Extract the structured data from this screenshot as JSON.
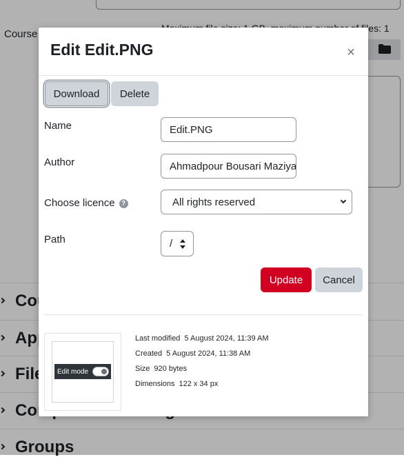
{
  "background": {
    "course_label": "Course",
    "max_size_text": "Maximum file size: 1 GB, maximum number of files: 1",
    "sections": [
      "Course",
      "Appearance",
      "Files",
      "Completion tracking",
      "Groups"
    ]
  },
  "dialog": {
    "title": "Edit Edit.PNG",
    "close_symbol": "×",
    "download_label": "Download",
    "delete_label": "Delete",
    "name_label": "Name",
    "name_value": "Edit.PNG",
    "author_label": "Author",
    "author_value": "Ahmadpour Bousari Maziyar",
    "licence_label": "Choose licence",
    "licence_help": "?",
    "licence_value": "All rights reserved",
    "path_label": "Path",
    "path_value": "/",
    "update_label": "Update",
    "cancel_label": "Cancel"
  },
  "file_info": {
    "thumbnail_text": "Edit mode",
    "last_modified_label": "Last modified",
    "last_modified_value": "5 August 2024, 11:39 AM",
    "created_label": "Created",
    "created_value": "5 August 2024, 11:38 AM",
    "size_label": "Size",
    "size_value": "920 bytes",
    "dimensions_label": "Dimensions",
    "dimensions_value": "122 x 34 px"
  },
  "colors": {
    "primary": "#d20020",
    "secondary": "#ced4da",
    "backdrop": "rgba(0,0,0,0.3)"
  }
}
